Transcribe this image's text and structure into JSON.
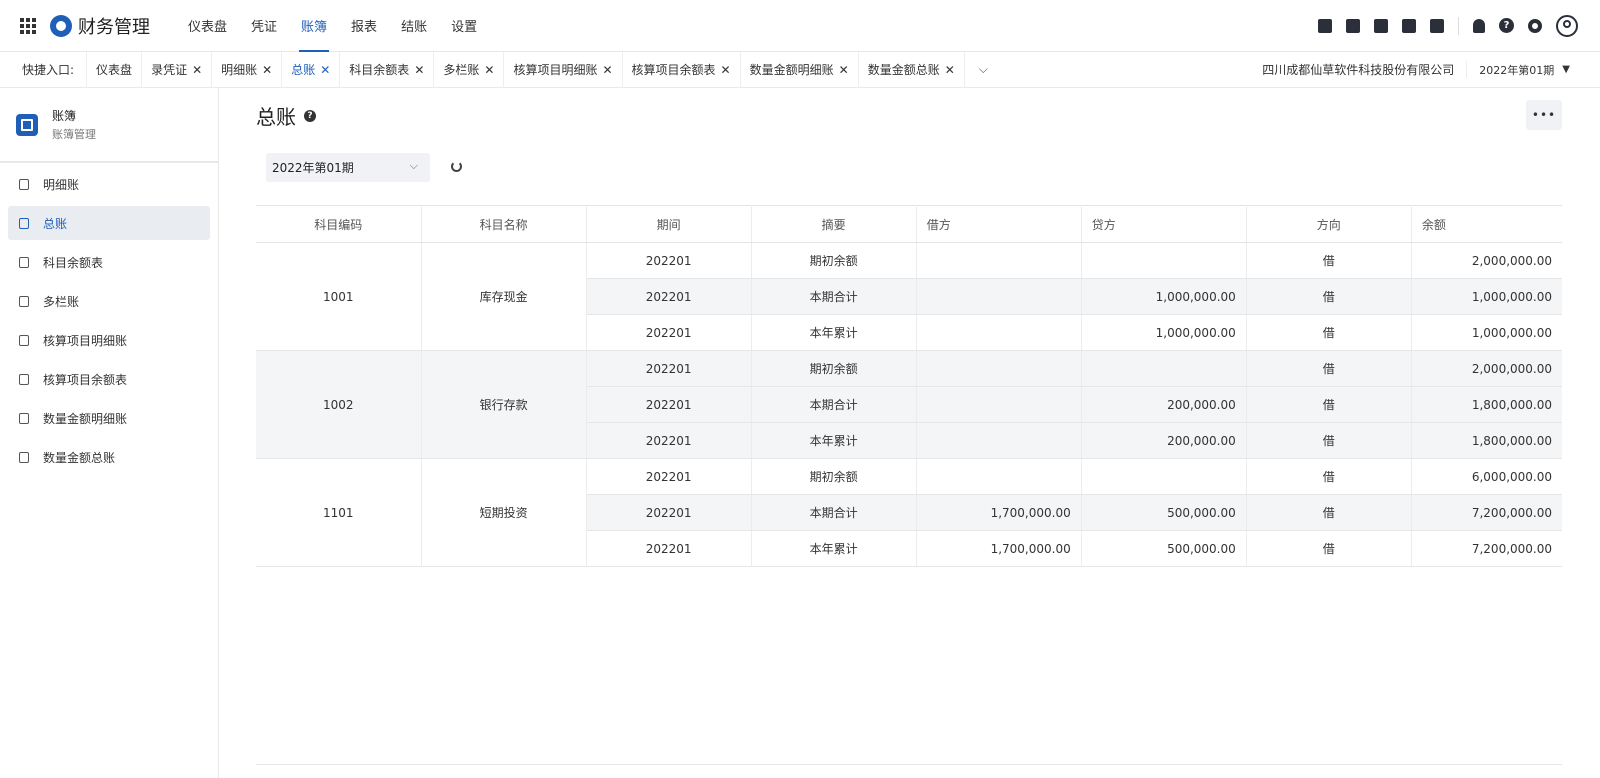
{
  "app": {
    "title": "财务管理",
    "logo": "app-logo-icon"
  },
  "topnav": [
    {
      "label": "仪表盘",
      "active": false
    },
    {
      "label": "凭证",
      "active": false
    },
    {
      "label": "账簿",
      "active": true
    },
    {
      "label": "报表",
      "active": false
    },
    {
      "label": "结账",
      "active": false
    },
    {
      "label": "设置",
      "active": false
    }
  ],
  "quick": {
    "label": "快捷入口:",
    "tabs": [
      {
        "label": "仪表盘",
        "closable": false
      },
      {
        "label": "录凭证",
        "closable": true
      },
      {
        "label": "明细账",
        "closable": true
      },
      {
        "label": "总账",
        "closable": true
      },
      {
        "label": "科目余额表",
        "closable": true
      },
      {
        "label": "多栏账",
        "closable": true
      },
      {
        "label": "核算项目明细账",
        "closable": true
      },
      {
        "label": "核算项目余额表",
        "closable": true
      },
      {
        "label": "数量金额明细账",
        "closable": true
      },
      {
        "label": "数量金额总账",
        "closable": true
      }
    ],
    "close_glyph": "✕",
    "company": "四川成都仙草软件科技股份有限公司",
    "period": "2022年第01期"
  },
  "sidebar": {
    "title": "账簿",
    "subtitle": "账簿管理",
    "items": [
      {
        "label": "明细账",
        "active": false
      },
      {
        "label": "总账",
        "active": true
      },
      {
        "label": "科目余额表",
        "active": false
      },
      {
        "label": "多栏账",
        "active": false
      },
      {
        "label": "核算项目明细账",
        "active": false
      },
      {
        "label": "核算项目余额表",
        "active": false
      },
      {
        "label": "数量金额明细账",
        "active": false
      },
      {
        "label": "数量金额总账",
        "active": false
      }
    ]
  },
  "main": {
    "title": "总账",
    "more_label": "•••",
    "period_select": "2022年第01期",
    "columns": [
      "科目编码",
      "科目名称",
      "期间",
      "摘要",
      "借方",
      "贷方",
      "方向",
      "余额"
    ],
    "groups": [
      {
        "code": "1001",
        "name": "库存现金",
        "rows": [
          {
            "period": "202201",
            "summary": "期初余额",
            "debit": "",
            "credit": "",
            "dir": "借",
            "balance": "2,000,000.00"
          },
          {
            "period": "202201",
            "summary": "本期合计",
            "debit": "",
            "credit": "1,000,000.00",
            "dir": "借",
            "balance": "1,000,000.00"
          },
          {
            "period": "202201",
            "summary": "本年累计",
            "debit": "",
            "credit": "1,000,000.00",
            "dir": "借",
            "balance": "1,000,000.00"
          }
        ]
      },
      {
        "code": "1002",
        "name": "银行存款",
        "rows": [
          {
            "period": "202201",
            "summary": "期初余额",
            "debit": "",
            "credit": "",
            "dir": "借",
            "balance": "2,000,000.00"
          },
          {
            "period": "202201",
            "summary": "本期合计",
            "debit": "",
            "credit": "200,000.00",
            "dir": "借",
            "balance": "1,800,000.00"
          },
          {
            "period": "202201",
            "summary": "本年累计",
            "debit": "",
            "credit": "200,000.00",
            "dir": "借",
            "balance": "1,800,000.00"
          }
        ]
      },
      {
        "code": "1101",
        "name": "短期投资",
        "rows": [
          {
            "period": "202201",
            "summary": "期初余额",
            "debit": "",
            "credit": "",
            "dir": "借",
            "balance": "6,000,000.00"
          },
          {
            "period": "202201",
            "summary": "本期合计",
            "debit": "1,700,000.00",
            "credit": "500,000.00",
            "dir": "借",
            "balance": "7,200,000.00"
          },
          {
            "period": "202201",
            "summary": "本年累计",
            "debit": "1,700,000.00",
            "credit": "500,000.00",
            "dir": "借",
            "balance": "7,200,000.00"
          }
        ]
      }
    ]
  },
  "colors": {
    "accent": "#1f5fb8",
    "shade": "#f4f5f7"
  }
}
